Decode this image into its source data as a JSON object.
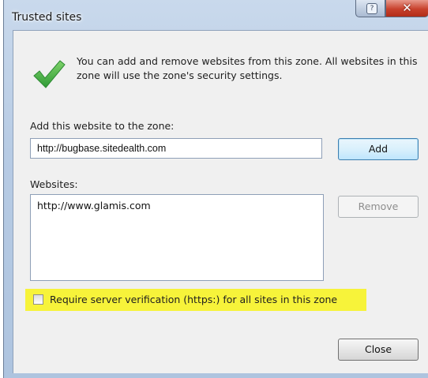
{
  "window": {
    "title": "Trusted sites",
    "help_glyph": "?",
    "close_glyph": "✕"
  },
  "info": {
    "icon": "green-checkmark-icon",
    "text": "You can add and remove websites from this zone. All websites in this zone will use the zone's security settings."
  },
  "add": {
    "label": "Add this website to the zone:",
    "value": "http://bugbase.sitedealth.com",
    "button": "Add"
  },
  "websites": {
    "label": "Websites:",
    "items": [
      "http://www.glamis.com"
    ],
    "remove_button": "Remove"
  },
  "require_https": {
    "label": "Require server verification (https:) for all sites in this zone",
    "checked": false,
    "highlight_color": "#f7f33a"
  },
  "footer": {
    "close_button": "Close"
  },
  "colors": {
    "accent_check": "#3aa541",
    "title_close_bg": "#c8412c"
  }
}
